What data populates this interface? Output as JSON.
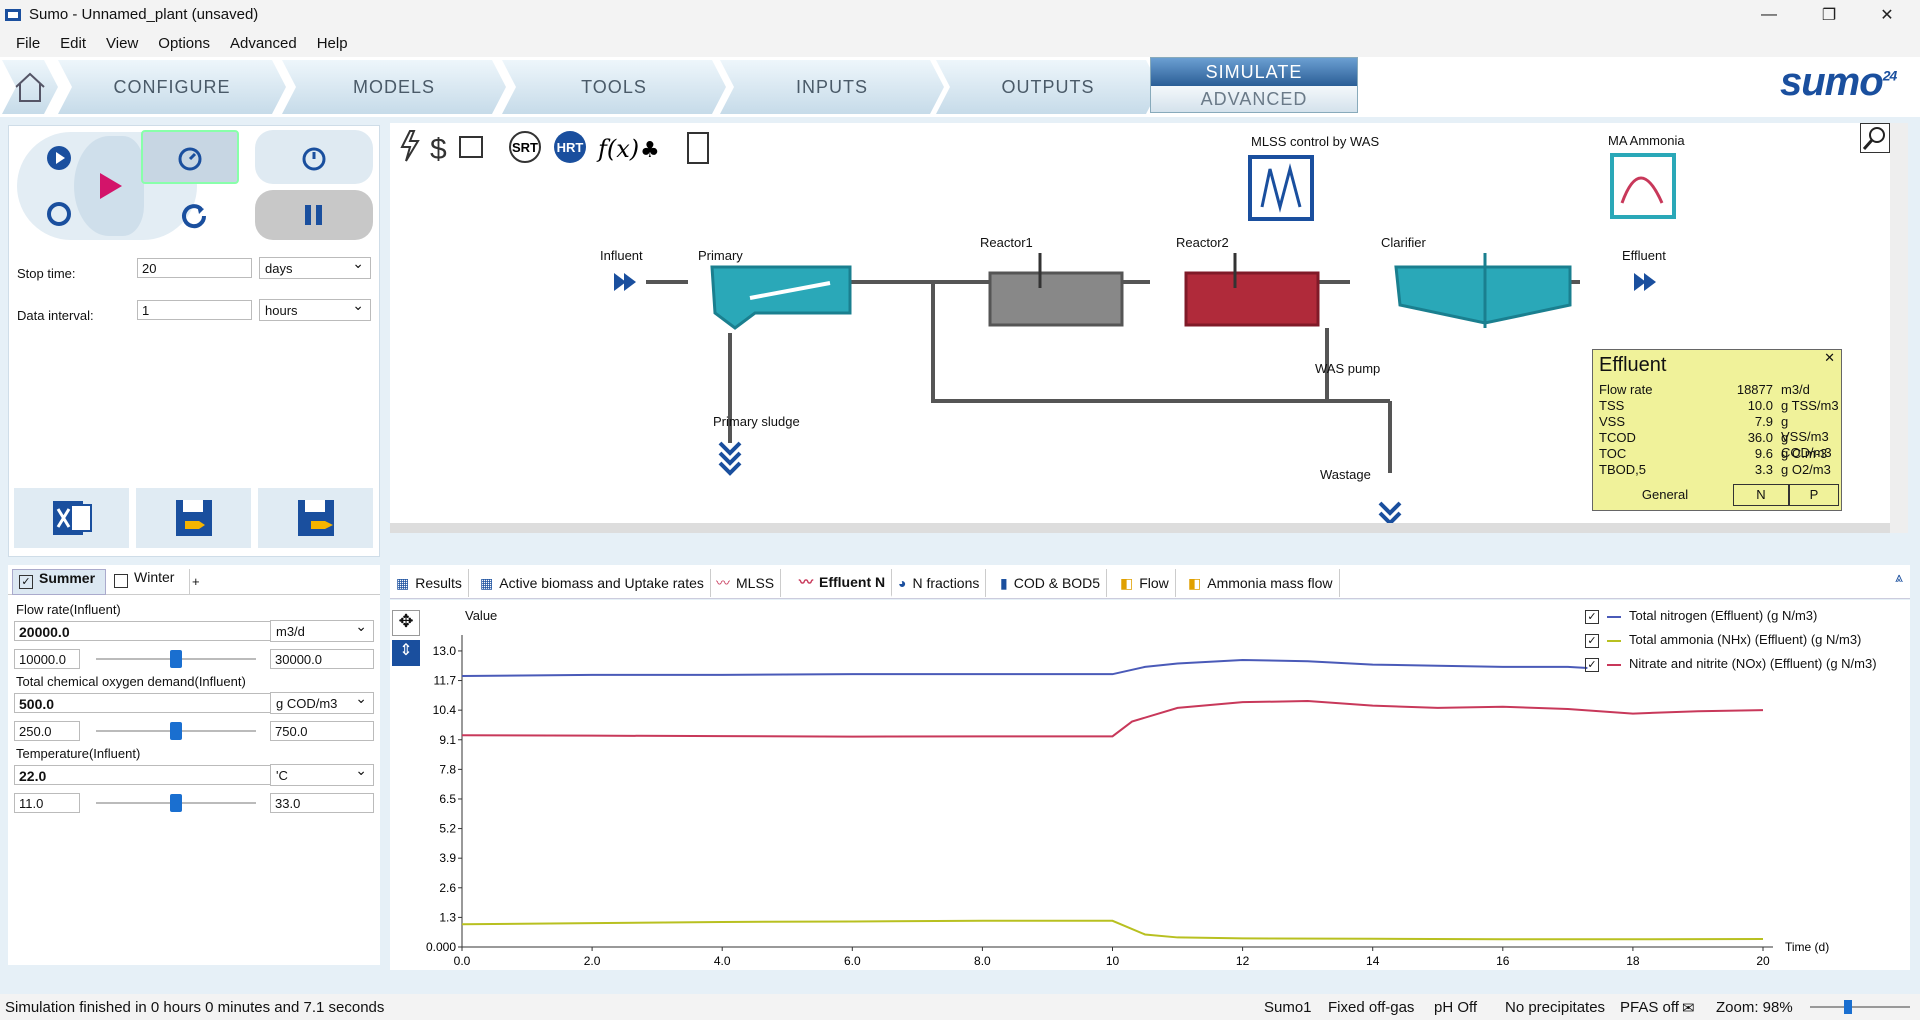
{
  "window": {
    "title": "Sumo - Unnamed_plant (unsaved)"
  },
  "menu": [
    "File",
    "Edit",
    "View",
    "Options",
    "Advanced",
    "Help"
  ],
  "nav": {
    "tabs": [
      "CONFIGURE",
      "MODELS",
      "TOOLS",
      "INPUTS",
      "OUTPUTS"
    ],
    "simulate": "SIMULATE",
    "advanced": "ADVANCED",
    "logo": "sumo",
    "logo_ver": "24"
  },
  "sim": {
    "stop_label": "Stop time:",
    "stop_value": "20",
    "stop_unit": "days",
    "interval_label": "Data interval:",
    "interval_value": "1",
    "interval_unit": "hours"
  },
  "scenarios": {
    "tabs": [
      "Summer",
      "Winter",
      "+"
    ],
    "params": [
      {
        "label": "Flow rate(Influent)",
        "value": "20000.0",
        "unit": "m3/d",
        "min": "10000.0",
        "max": "30000.0",
        "level": 0.5
      },
      {
        "label": "Total chemical oxygen demand(Influent)",
        "value": "500.0",
        "unit": "g COD/m3",
        "min": "250.0",
        "max": "750.0",
        "level": 0.5
      },
      {
        "label": "Temperature(Influent)",
        "value": "22.0",
        "unit": "'C",
        "min": "11.0",
        "max": "33.0",
        "level": 0.5
      }
    ]
  },
  "diagram": {
    "units": [
      "Influent",
      "Primary",
      "Reactor1",
      "Reactor2",
      "Clarifier",
      "Effluent",
      "Primary sludge",
      "WAS pump",
      "Wastage",
      "MLSS control by WAS",
      "MA Ammonia"
    ],
    "toolbar_text": [
      "SRT",
      "HRT"
    ]
  },
  "popup": {
    "title": "Effluent",
    "rows": [
      {
        "name": "Flow rate",
        "value": "18877",
        "unit": "m3/d"
      },
      {
        "name": "TSS",
        "value": "10.0",
        "unit": "g TSS/m3"
      },
      {
        "name": "VSS",
        "value": "7.9",
        "unit": "g VSS/m3"
      },
      {
        "name": "TCOD",
        "value": "36.0",
        "unit": "g COD/m3"
      },
      {
        "name": "TOC",
        "value": "9.6",
        "unit": "g C.m-3"
      },
      {
        "name": "TBOD,5",
        "value": "3.3",
        "unit": "g O2/m3"
      }
    ],
    "tabs": [
      "General",
      "N",
      "P"
    ]
  },
  "plot_tabs": [
    "Results",
    "Active biomass and Uptake rates",
    "MLSS",
    "Effluent N",
    "N fractions",
    "COD & BOD5",
    "Flow",
    "Ammonia mass flow"
  ],
  "chart_data": {
    "type": "line",
    "ylabel": "Value",
    "xlabel": "Time  (d)",
    "yticks": [
      "0.000",
      "1.3",
      "2.6",
      "3.9",
      "5.2",
      "6.5",
      "7.8",
      "9.1",
      "10.4",
      "11.7",
      "13.0"
    ],
    "xticks": [
      "0.0",
      "2.0",
      "4.0",
      "6.0",
      "8.0",
      "10",
      "12",
      "14",
      "16",
      "18",
      "20"
    ],
    "xlim": [
      0,
      20
    ],
    "ylim": [
      0,
      13.7
    ],
    "series": [
      {
        "name": "Total nitrogen (Effluent) (g N/m3)",
        "color": "#4a5ab8",
        "x": [
          0,
          2,
          4,
          6,
          8,
          10,
          10.5,
          11,
          12,
          13,
          14,
          15,
          16,
          17,
          17.3
        ],
        "values": [
          11.9,
          11.95,
          11.95,
          11.98,
          11.98,
          11.98,
          12.3,
          12.45,
          12.6,
          12.55,
          12.4,
          12.35,
          12.3,
          12.3,
          12.25
        ]
      },
      {
        "name": "Total ammonia (NHx) (Effluent) (g N/m3)",
        "color": "#b8c020",
        "x": [
          0,
          2,
          4,
          6,
          8,
          10,
          10.5,
          11,
          12,
          14,
          16,
          18,
          20
        ],
        "values": [
          1.0,
          1.05,
          1.1,
          1.12,
          1.15,
          1.15,
          0.55,
          0.42,
          0.38,
          0.36,
          0.34,
          0.34,
          0.35
        ]
      },
      {
        "name": "Nitrate and nitrite (NOx) (Effluent) (g N/m3)",
        "color": "#c8385a",
        "x": [
          0,
          2,
          4,
          6,
          8,
          10,
          10.3,
          11,
          12,
          13,
          14,
          15,
          16,
          17,
          18,
          19,
          20
        ],
        "values": [
          9.3,
          9.28,
          9.26,
          9.24,
          9.25,
          9.25,
          9.9,
          10.5,
          10.75,
          10.8,
          10.6,
          10.5,
          10.55,
          10.45,
          10.25,
          10.35,
          10.4
        ]
      }
    ]
  },
  "status": {
    "left": "Simulation finished in 0 hours 0 minutes and 7.1 seconds",
    "items": [
      "Sumo1",
      "Fixed off-gas",
      "pH Off",
      "No precipitates",
      "PFAS off"
    ],
    "zoom": "Zoom: 98%"
  }
}
